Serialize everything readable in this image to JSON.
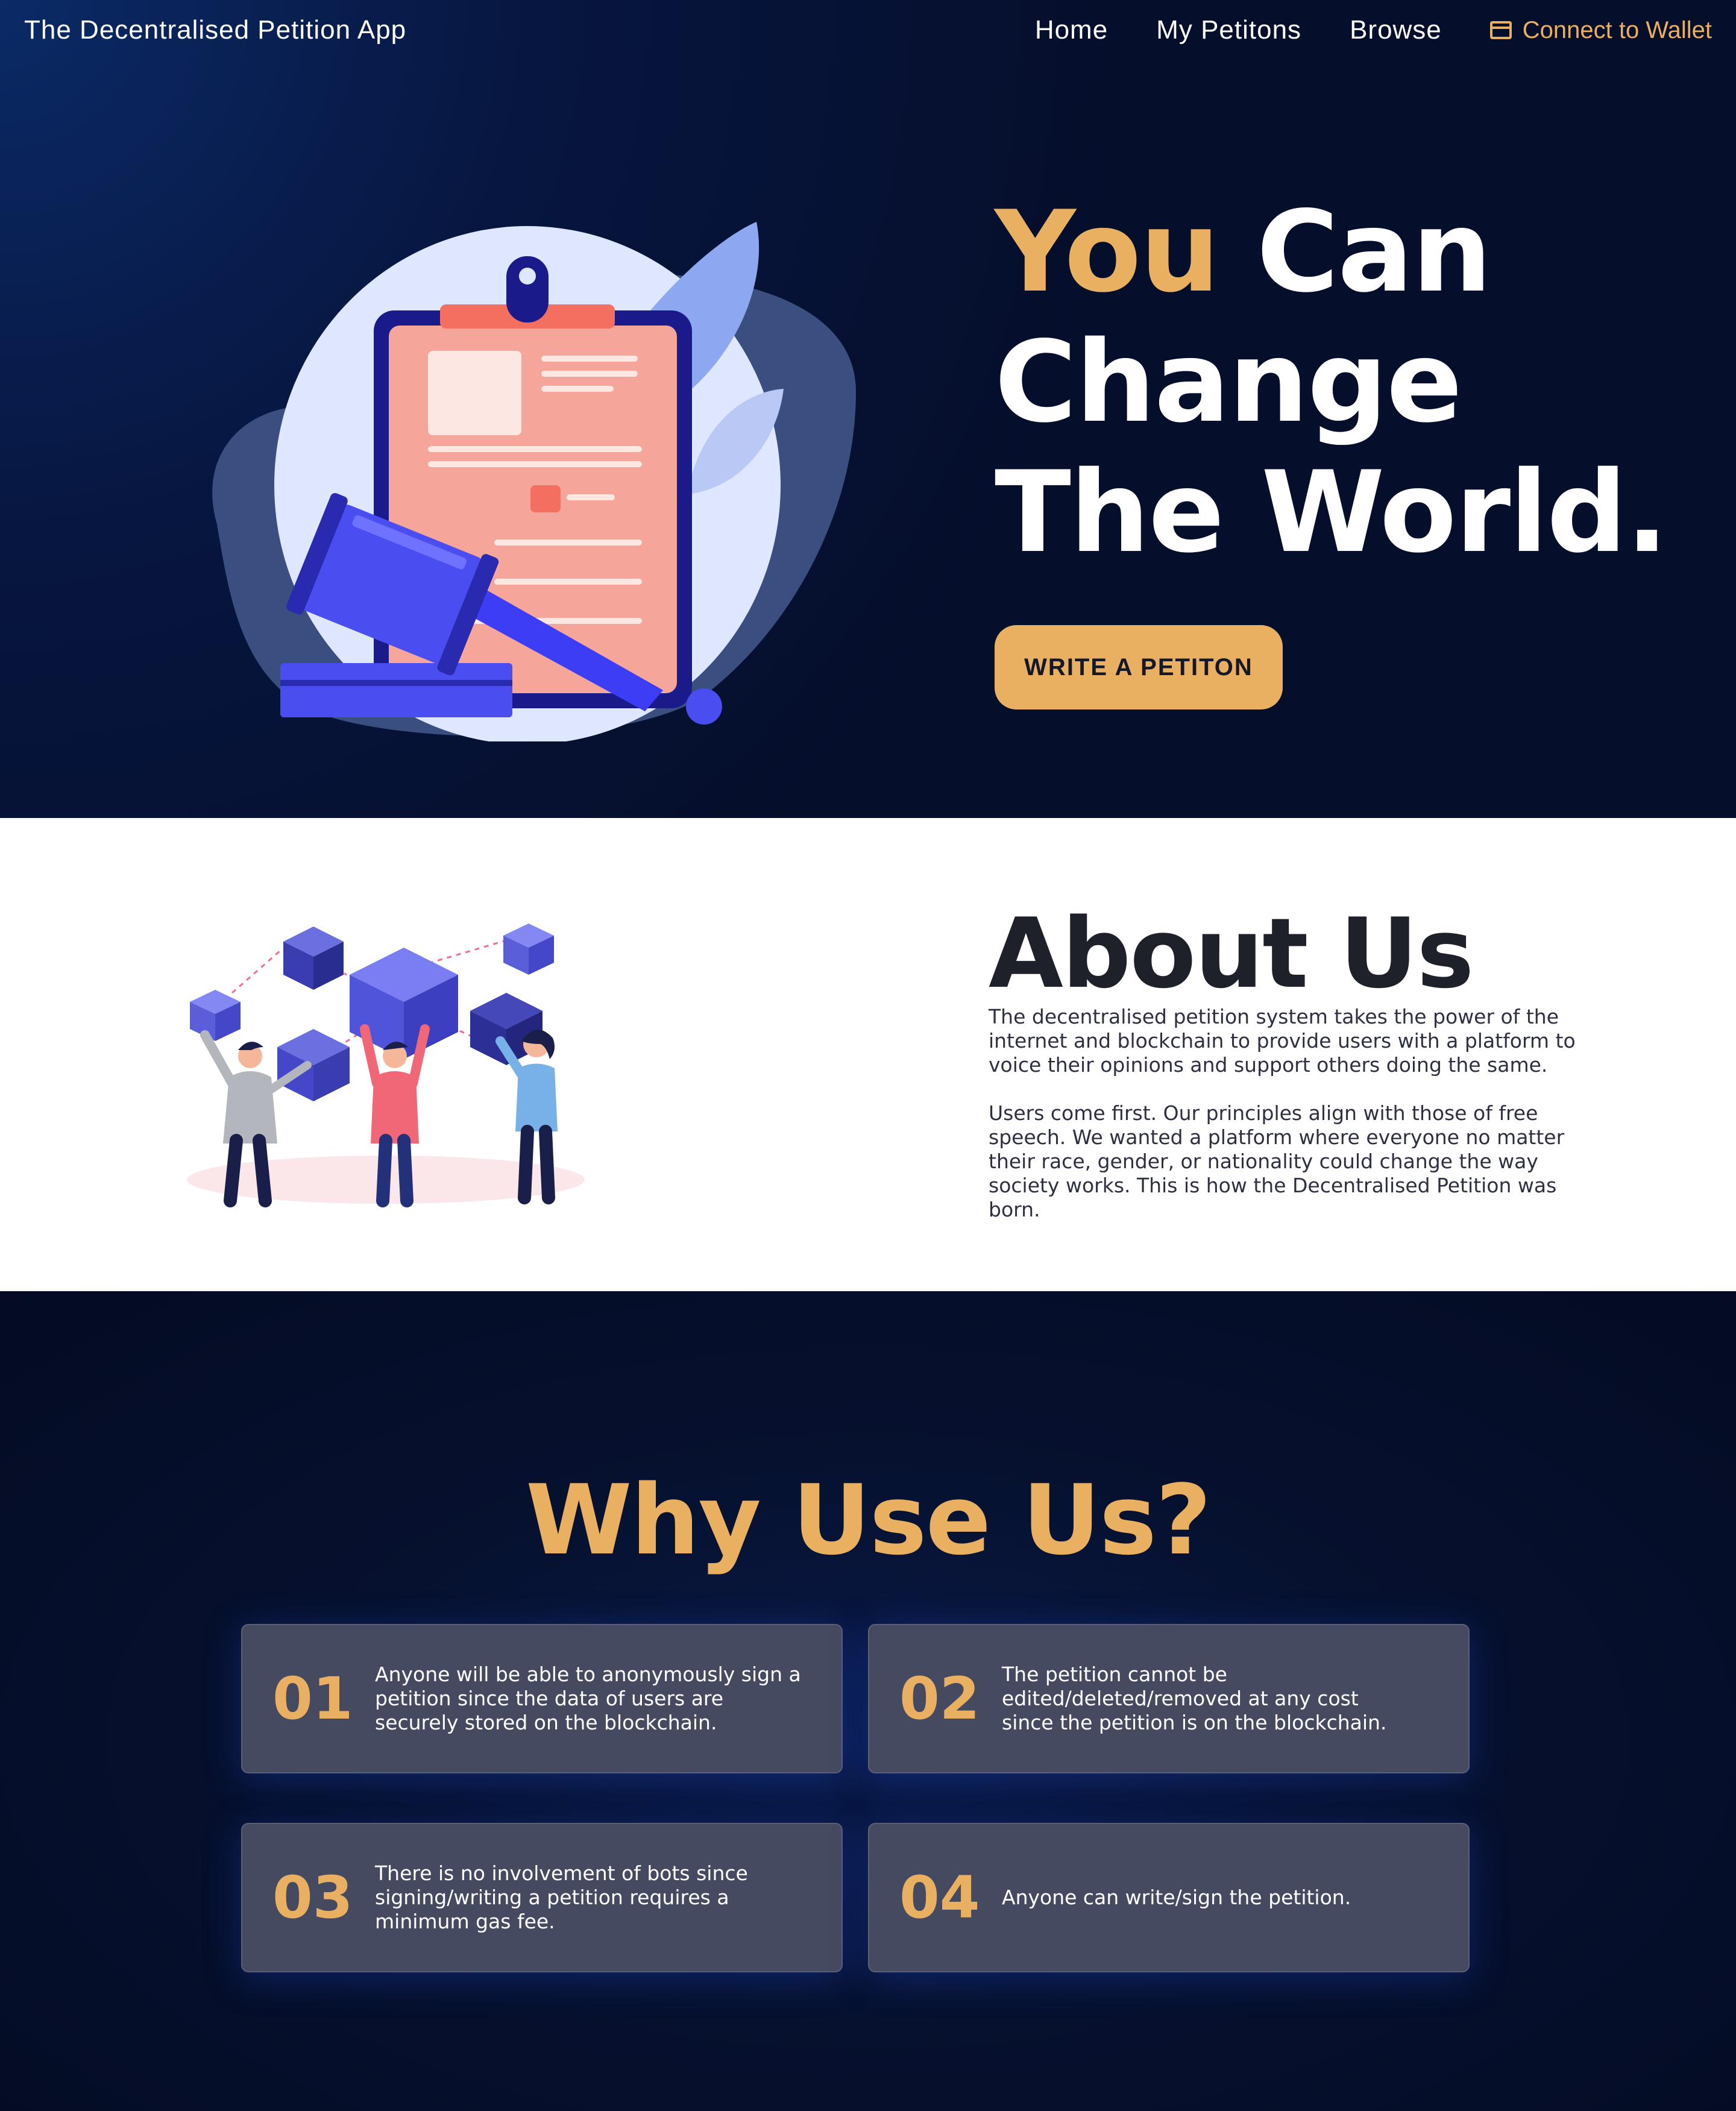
{
  "navbar": {
    "brand": "The Decentralised Petition App",
    "links": [
      "Home",
      "My Petitons",
      "Browse"
    ],
    "wallet_label": "Connect to Wallet"
  },
  "hero": {
    "title_accent": "You",
    "title_line1_rest": " Can",
    "title_line2": "Change",
    "title_line3": "The World.",
    "cta_label": "WRITE A PETITON"
  },
  "about": {
    "title": "About Us",
    "paragraphs": [
      "The decentralised petition system takes the power of the internet and blockchain to provide users with a platform to voice their opinions and support others doing the same.",
      "Users come first. Our principles align with those of free speech. We wanted a platform where everyone no matter their race, gender, or nationality could change the way society works. This is how the Decentralised Petition was born."
    ]
  },
  "why": {
    "title": "Why Use Us?",
    "cards": [
      {
        "number": "01",
        "text": "Anyone will be able to anonymously sign a petition since the data of users are securely stored on the blockchain."
      },
      {
        "number": "02",
        "text": "The petition cannot be edited/deleted/removed at any cost since the petition is on the blockchain."
      },
      {
        "number": "03",
        "text": "There is no involvement of bots since signing/writing a petition requires a minimum gas fee."
      },
      {
        "number": "04",
        "text": "Anyone can write/sign the petition."
      }
    ]
  },
  "colors": {
    "accent": "#e9b062",
    "dark_background": "#050e2a",
    "card_background": "#454a61"
  }
}
